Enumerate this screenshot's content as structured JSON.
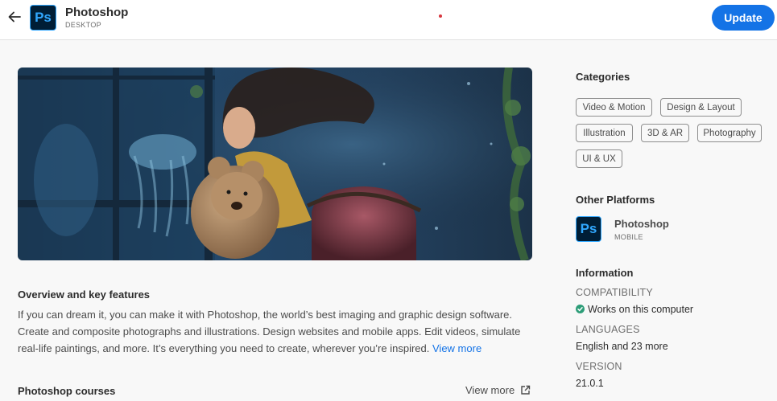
{
  "header": {
    "app_name": "Photoshop",
    "app_platform": "DESKTOP",
    "logo_text": "Ps",
    "update_label": "Update"
  },
  "overview": {
    "title": "Overview and key features",
    "description": "If you can dream it, you can make it with Photoshop, the world’s best imaging and graphic design software. Create and composite photographs and illustrations. Design websites and mobile apps. Edit videos, simulate real-life paintings, and more. It’s everything you need to create, wherever you’re inspired.",
    "view_more": "View more"
  },
  "courses": {
    "title": "Photoshop courses",
    "view_more": "View more"
  },
  "categories": {
    "title": "Categories",
    "items": [
      "Video & Motion",
      "Design & Layout",
      "Illustration",
      "3D & AR",
      "Photography",
      "UI & UX"
    ]
  },
  "other_platforms": {
    "title": "Other Platforms",
    "app_name": "Photoshop",
    "platform": "MOBILE",
    "logo_text": "Ps"
  },
  "information": {
    "title": "Information",
    "compatibility_label": "COMPATIBILITY",
    "compatibility_value": "Works on this computer",
    "languages_label": "LANGUAGES",
    "languages_value": "English and 23 more",
    "version_label": "VERSION",
    "version_value": "21.0.1"
  },
  "colors": {
    "accent": "#1473e6",
    "ps_blue": "#31a8ff",
    "ps_dark": "#001e36",
    "success": "#2d9d78"
  },
  "icons": [
    "back-arrow-icon",
    "external-link-icon",
    "check-circle-icon"
  ]
}
